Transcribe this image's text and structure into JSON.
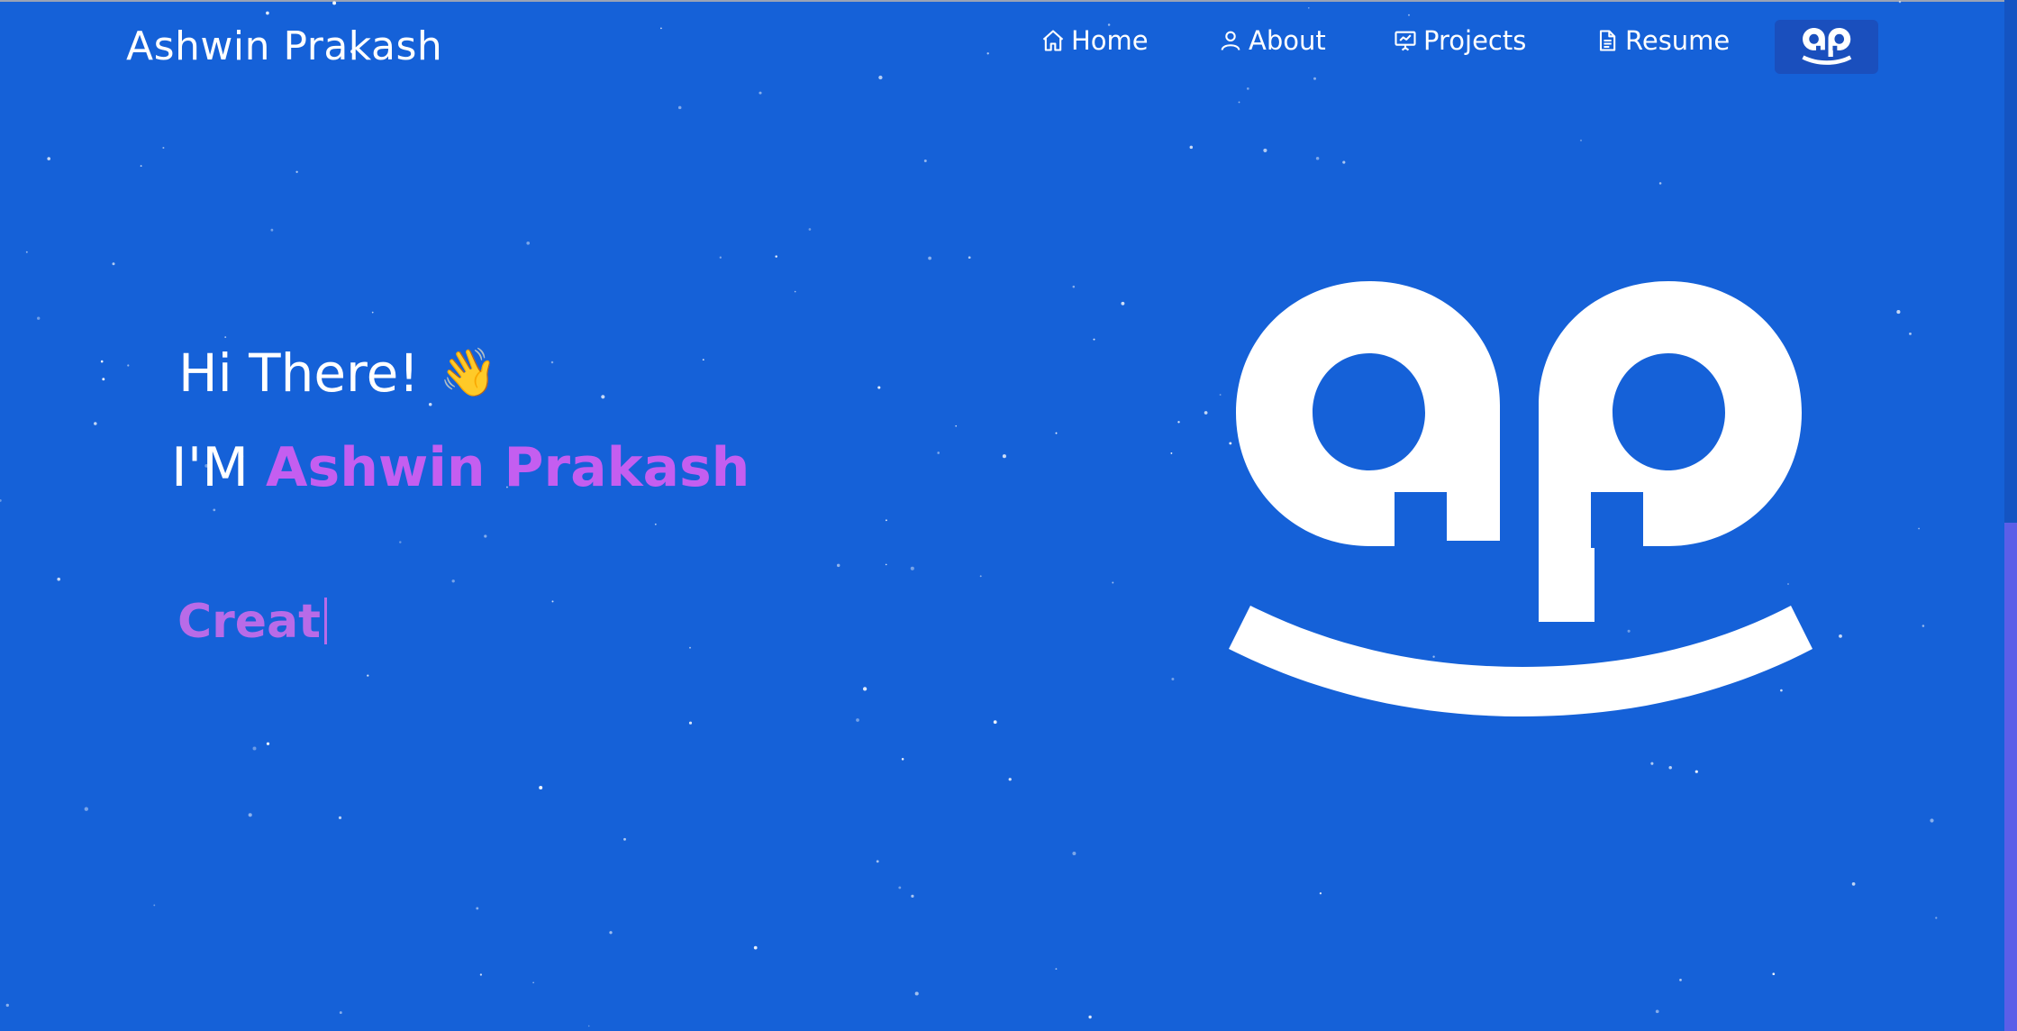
{
  "brand": "Ashwin Prakash",
  "nav": {
    "items": [
      {
        "label": "Home",
        "icon": "home-icon"
      },
      {
        "label": "About",
        "icon": "user-icon"
      },
      {
        "label": "Projects",
        "icon": "presentation-icon"
      },
      {
        "label": "Resume",
        "icon": "document-icon"
      }
    ],
    "logo_button_icon": "ap-logo-icon"
  },
  "hero": {
    "greeting": "Hi There!",
    "wave_emoji": "👋",
    "im_prefix": "I'M",
    "name": "Ashwin Prakash",
    "typed_text": "Creat"
  },
  "colors": {
    "background": "#1561d8",
    "accent_name": "#c45ef0",
    "accent_typed": "#b86be8",
    "logo_button_bg": "#1a4fbd"
  }
}
